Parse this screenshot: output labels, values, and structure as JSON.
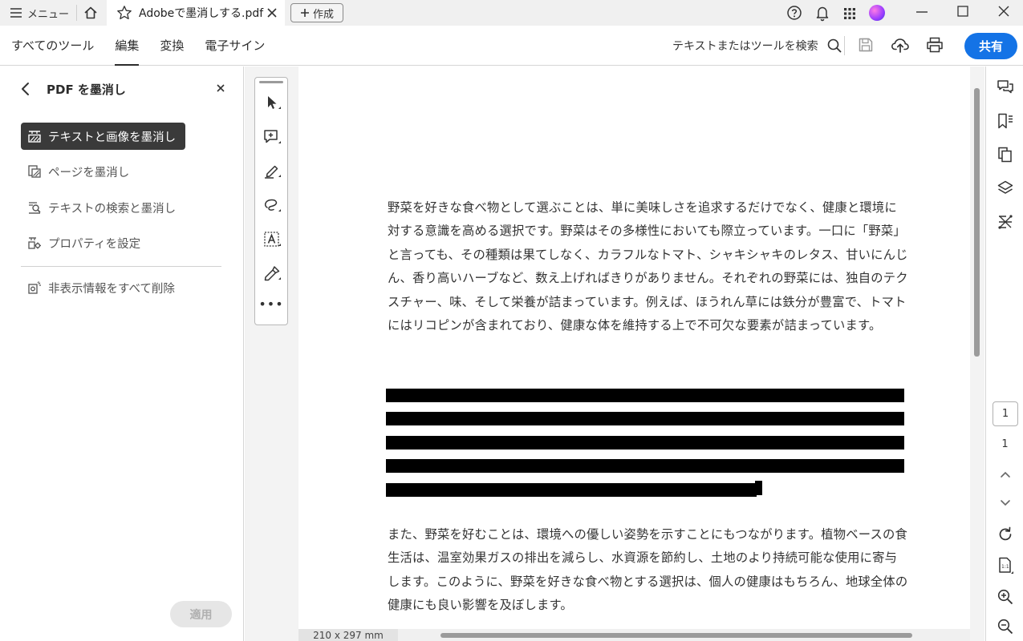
{
  "titlebar": {
    "menu_label": "メニュー",
    "tab_title": "Adobeで墨消しする.pdf",
    "new_tab_label": "作成"
  },
  "toolbar": {
    "nav": [
      "すべてのツール",
      "編集",
      "変換",
      "電子サイン"
    ],
    "active_nav": "編集",
    "search_label": "テキストまたはツールを検索",
    "share_label": "共有"
  },
  "panel": {
    "title": "PDF を墨消し",
    "items": [
      {
        "label": "テキストと画像を墨消し",
        "icon": "redact-text-image-icon",
        "active": true
      },
      {
        "label": "ページを墨消し",
        "icon": "redact-page-icon",
        "active": false
      },
      {
        "label": "テキストの検索と墨消し",
        "icon": "find-redact-icon",
        "active": false
      },
      {
        "label": "プロパティを設定",
        "icon": "properties-icon",
        "active": false
      }
    ],
    "remove_hidden_label": "非表示情報をすべて削除",
    "apply_label": "適用"
  },
  "document": {
    "paragraph1": "野菜を好きな食べ物として選ぶことは、単に美味しさを追求するだけでなく、健康と環境に対する意識を高める選択です。野菜はその多様性においても際立っています。一口に「野菜」と言っても、その種類は果てしなく、カラフルなトマト、シャキシャキのレタス、甘いにんじん、香り高いハーブなど、数え上げればきりがありません。それぞれの野菜には、独自のテクスチャー、味、そして栄養が詰まっています。例えば、ほうれん草には鉄分が豊富で、トマトにはリコピンが含まれており、健康な体を維持する上で不可欠な要素が詰まっています。",
    "paragraph2": "また、野菜を好むことは、環境への優しい姿勢を示すことにもつながります。植物ベースの食生活は、温室効果ガスの排出を減らし、水資源を節約し、土地のより持続可能な使用に寄与します。このように、野菜を好きな食べ物とする選択は、個人の健康はもちろん、地球全体の健康にも良い影響を及ぼします。",
    "redaction_lines": 5,
    "page_size": "210 x 297 mm"
  },
  "pagination": {
    "current": "1",
    "total": "1"
  },
  "colors": {
    "accent": "#1473e6",
    "panel_active_bg": "#3a3a3a",
    "redaction": "#000000"
  }
}
